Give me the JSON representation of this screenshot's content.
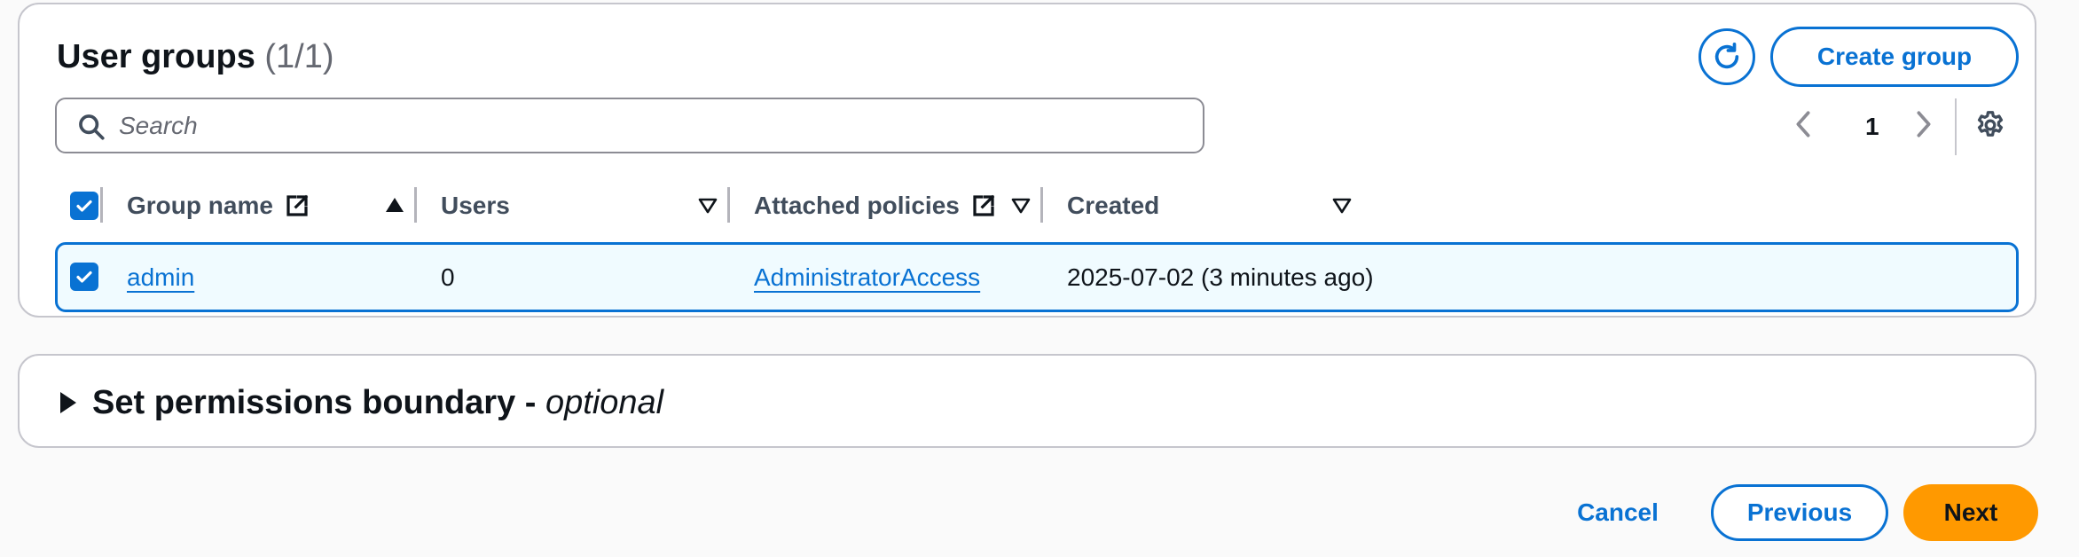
{
  "groups": {
    "title": "User groups",
    "count": "(1/1)",
    "create_label": "Create group",
    "search_placeholder": "Search",
    "page": "1",
    "columns": [
      {
        "label": "Group name",
        "external": true,
        "sort": "asc"
      },
      {
        "label": "Users",
        "sort": "none"
      },
      {
        "label": "Attached policies",
        "external": true,
        "sort": "none"
      },
      {
        "label": "Created",
        "sort": "none"
      }
    ],
    "rows": [
      {
        "selected": true,
        "name": "admin",
        "users": "0",
        "policies": "AdministratorAccess",
        "created": "2025-07-02 (3 minutes ago)"
      }
    ]
  },
  "boundary": {
    "label": "Set permissions boundary -",
    "label_optional": "optional"
  },
  "actions": {
    "cancel": "Cancel",
    "previous": "Previous",
    "next": "Next"
  },
  "icons": {
    "refresh": "refresh-icon",
    "search": "search-icon",
    "external": "external-link-icon",
    "settings": "gear-icon"
  },
  "colors": {
    "accent": "#0972d3",
    "primary_button": "#ff9900",
    "selected_row_bg": "#f0fbff"
  }
}
